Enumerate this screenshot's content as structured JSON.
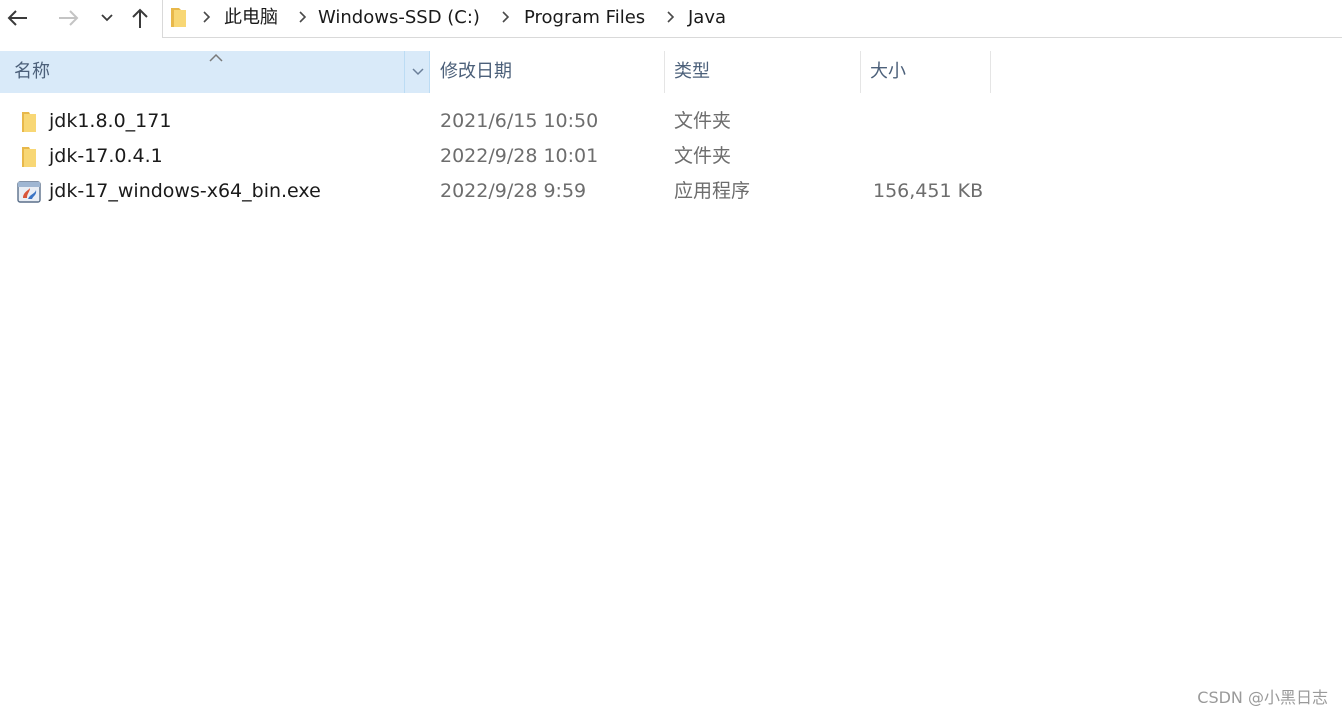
{
  "nav": {
    "back_icon": "arrow-left-icon",
    "forward_icon": "arrow-right-icon",
    "recent_icon": "chevron-down-icon",
    "up_icon": "arrow-up-icon"
  },
  "breadcrumb": [
    "此电脑",
    "Windows-SSD (C:)",
    "Program Files",
    "Java"
  ],
  "columns": {
    "name": "名称",
    "date": "修改日期",
    "type": "类型",
    "size": "大小"
  },
  "files": [
    {
      "name": "jdk1.8.0_171",
      "date": "2021/6/15 10:50",
      "type": "文件夹",
      "size": "",
      "icon": "folder-icon"
    },
    {
      "name": "jdk-17.0.4.1",
      "date": "2022/9/28 10:01",
      "type": "文件夹",
      "size": "",
      "icon": "folder-icon"
    },
    {
      "name": "jdk-17_windows-x64_bin.exe",
      "date": "2022/9/28 9:59",
      "type": "应用程序",
      "size": "156,451 KB",
      "icon": "installer-icon"
    }
  ],
  "watermark": "CSDN @小黑日志",
  "colors": {
    "header_selected_bg": "#d9eaf9",
    "header_text": "#4c607a",
    "folder_yellow": "#f8d775",
    "secondary_text": "#6d6d6d"
  }
}
